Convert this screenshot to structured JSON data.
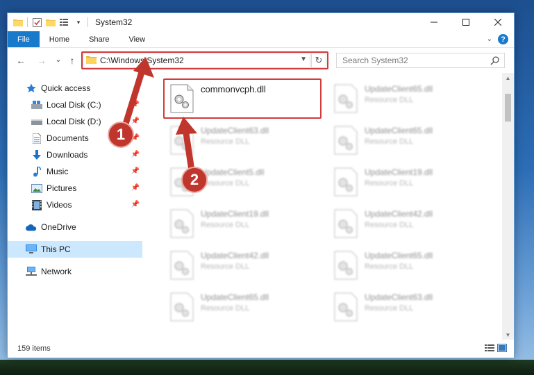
{
  "window": {
    "title": "System32",
    "controls": {
      "minimize": "—",
      "maximize": "☐",
      "close": "✕"
    }
  },
  "ribbon": {
    "tabs": [
      "File",
      "Home",
      "Share",
      "View"
    ],
    "help": "?"
  },
  "navbar": {
    "back": "←",
    "forward": "→",
    "recent": "⌄",
    "up": "↑",
    "address": "C:\\Windows\\System32",
    "refresh": "↻",
    "search_placeholder": "Search System32"
  },
  "sidebar": {
    "items": [
      {
        "label": "Quick access",
        "icon": "star-icon",
        "pinned": false
      },
      {
        "label": "Local Disk (C:)",
        "icon": "drive-icon",
        "pinned": true
      },
      {
        "label": "Local Disk (D:)",
        "icon": "drive-icon",
        "pinned": true
      },
      {
        "label": "Documents",
        "icon": "documents-icon",
        "pinned": true
      },
      {
        "label": "Downloads",
        "icon": "download-icon",
        "pinned": true
      },
      {
        "label": "Music",
        "icon": "music-icon",
        "pinned": true
      },
      {
        "label": "Pictures",
        "icon": "pictures-icon",
        "pinned": true
      },
      {
        "label": "Videos",
        "icon": "videos-icon",
        "pinned": true
      },
      {
        "label": "OneDrive",
        "icon": "cloud-icon",
        "pinned": false
      },
      {
        "label": "This PC",
        "icon": "computer-icon",
        "pinned": false,
        "selected": true
      },
      {
        "label": "Network",
        "icon": "network-icon",
        "pinned": false
      }
    ]
  },
  "files": [
    {
      "name": "commonvcph.dll",
      "type": "",
      "highlight": true
    },
    {
      "name": "UpdateClient65.dll",
      "type": "Resource DLL"
    },
    {
      "name": "UpdateClient63.dll",
      "type": "Resource DLL"
    },
    {
      "name": "UpdateClient65.dll",
      "type": "Resource DLL"
    },
    {
      "name": "UpdateClient5.dll",
      "type": "Resource DLL"
    },
    {
      "name": "UpdateClient19.dll",
      "type": "Resource DLL"
    },
    {
      "name": "UpdateClient19.dll",
      "type": "Resource DLL"
    },
    {
      "name": "UpdateClient42.dll",
      "type": "Resource DLL"
    },
    {
      "name": "UpdateClient42.dll",
      "type": "Resource DLL"
    },
    {
      "name": "UpdateClient65.dll",
      "type": "Resource DLL"
    },
    {
      "name": "UpdateClient65.dll",
      "type": "Resource DLL"
    },
    {
      "name": "UpdateClient63.dll",
      "type": "Resource DLL"
    }
  ],
  "status": {
    "item_count": "159 items"
  },
  "annotations": {
    "step1": "1",
    "step2": "2",
    "color": "#d23b3b"
  }
}
